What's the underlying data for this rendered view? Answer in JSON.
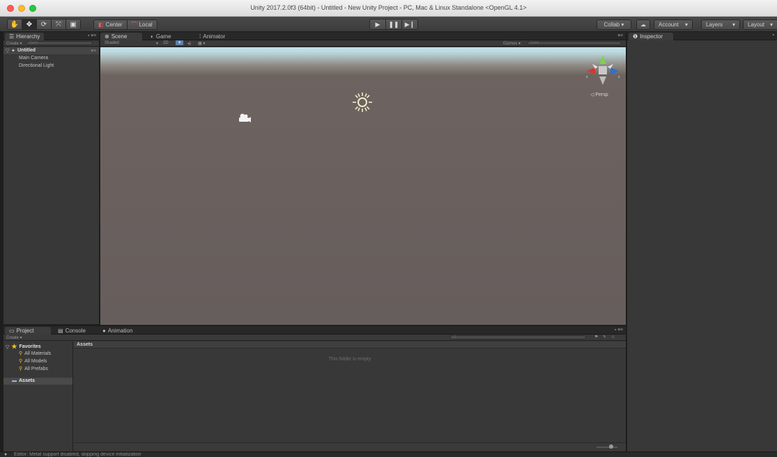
{
  "window": {
    "title": "Unity 2017.2.0f3 (64bit) - Untitled - New Unity Project - PC, Mac & Linux Standalone <OpenGL 4.1>"
  },
  "toolbar": {
    "pivot": "Center",
    "space": "Local",
    "collab": "Collab ▾",
    "account": "Account",
    "layers": "Layers",
    "layout": "Layout"
  },
  "hierarchy": {
    "tab": "Hierarchy",
    "create": "Create ▾",
    "search_placeholder": "Q▾All",
    "scene_name": "Untitled",
    "items": [
      "Main Camera",
      "Directional Light"
    ]
  },
  "scene": {
    "tabs": {
      "scene": "Scene",
      "game": "Game",
      "animator": "Animator"
    },
    "shading": "Shaded",
    "mode_2d": "2D",
    "gizmos": "Gizmos ▾",
    "gizmos_search": "Q▾All",
    "persp_label": "◁ Persp",
    "sky_color": "#c4e4ea",
    "ground_color": "#665e5c"
  },
  "inspector": {
    "tab": "Inspector"
  },
  "project": {
    "tabs": {
      "project": "Project",
      "console": "Console",
      "animation": "Animation"
    },
    "create": "Create ▾",
    "favorites": "Favorites",
    "favorite_items": [
      "All Materials",
      "All Models",
      "All Prefabs"
    ],
    "assets_folder": "Assets",
    "assets_header": "Assets",
    "empty_text": "This folder is empty",
    "search_placeholder": "Q"
  },
  "status": {
    "message": "Editor: Metal support disabled, skipping device initialization"
  },
  "colors": {
    "accent": "#3a72b0",
    "panel": "#383838",
    "tab_bar": "#282828"
  }
}
